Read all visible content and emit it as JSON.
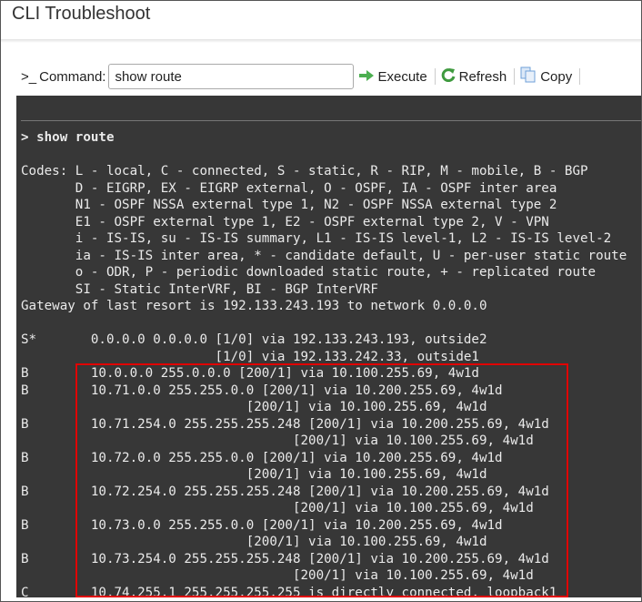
{
  "header": {
    "title": "CLI Troubleshoot"
  },
  "toolbar": {
    "prompt_icon": ">_",
    "command_label": "Command:",
    "command_value": "show route",
    "execute_label": "Execute",
    "refresh_label": "Refresh",
    "copy_label": "Copy",
    "colors": {
      "execute": "#4caf50",
      "refresh": "#3f9a3f",
      "copy": "#6fa0d8"
    }
  },
  "terminal": {
    "command_line": "> show route",
    "lines": [
      "",
      "Codes: L - local, C - connected, S - static, R - RIP, M - mobile, B - BGP",
      "       D - EIGRP, EX - EIGRP external, O - OSPF, IA - OSPF inter area",
      "       N1 - OSPF NSSA external type 1, N2 - OSPF NSSA external type 2",
      "       E1 - OSPF external type 1, E2 - OSPF external type 2, V - VPN",
      "       i - IS-IS, su - IS-IS summary, L1 - IS-IS level-1, L2 - IS-IS level-2",
      "       ia - IS-IS inter area, * - candidate default, U - per-user static route",
      "       o - ODR, P - periodic downloaded static route, + - replicated route",
      "       SI - Static InterVRF, BI - BGP InterVRF",
      "Gateway of last resort is 192.133.243.193 to network 0.0.0.0",
      "",
      "S*       0.0.0.0 0.0.0.0 [1/0] via 192.133.243.193, outside2",
      "                         [1/0] via 192.133.242.33, outside1",
      "B        10.0.0.0 255.0.0.0 [200/1] via 10.100.255.69, 4w1d",
      "B        10.71.0.0 255.255.0.0 [200/1] via 10.200.255.69, 4w1d",
      "                             [200/1] via 10.100.255.69, 4w1d",
      "B        10.71.254.0 255.255.255.248 [200/1] via 10.200.255.69, 4w1d",
      "                                   [200/1] via 10.100.255.69, 4w1d",
      "B        10.72.0.0 255.255.0.0 [200/1] via 10.200.255.69, 4w1d",
      "                             [200/1] via 10.100.255.69, 4w1d",
      "B        10.72.254.0 255.255.255.248 [200/1] via 10.200.255.69, 4w1d",
      "                                   [200/1] via 10.100.255.69, 4w1d",
      "B        10.73.0.0 255.255.0.0 [200/1] via 10.200.255.69, 4w1d",
      "                             [200/1] via 10.100.255.69, 4w1d",
      "B        10.73.254.0 255.255.255.248 [200/1] via 10.200.255.69, 4w1d",
      "                                   [200/1] via 10.100.255.69, 4w1d",
      "C        10.74.255.1 255.255.255.255 is directly connected, loopback1"
    ]
  },
  "highlight_color": "#e00000"
}
